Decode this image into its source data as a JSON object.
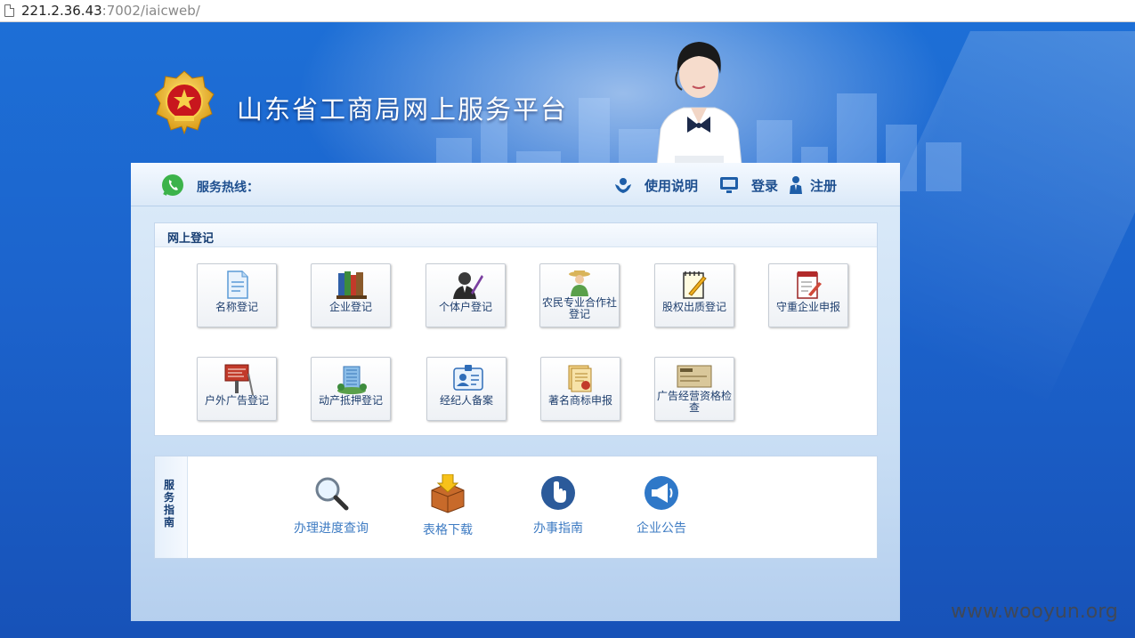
{
  "browser": {
    "url_host": "221.2.36.43",
    "url_path": ":7002/iaicweb/"
  },
  "header": {
    "site_title": "山东省工商局网上服务平台"
  },
  "topbar": {
    "hotline_label": "服务热线：",
    "help_label": "使用说明",
    "login_label": "登录",
    "register_label": "注册"
  },
  "online_registration": {
    "title": "网上登记",
    "items": [
      {
        "label": "名称登记",
        "icon": "document-icon"
      },
      {
        "label": "企业登记",
        "icon": "books-icon"
      },
      {
        "label": "个体户登记",
        "icon": "person-pen-icon"
      },
      {
        "label": "农民专业合作社登记",
        "icon": "farmer-icon"
      },
      {
        "label": "股权出质登记",
        "icon": "notepad-pen-icon"
      },
      {
        "label": "守重企业申报",
        "icon": "clipboard-icon"
      },
      {
        "label": "户外广告登记",
        "icon": "billboard-icon"
      },
      {
        "label": "动产抵押登记",
        "icon": "building-icon"
      },
      {
        "label": "经纪人备案",
        "icon": "id-card-icon"
      },
      {
        "label": "著名商标申报",
        "icon": "trademark-icon"
      },
      {
        "label": "广告经营资格检查",
        "icon": "check-icon"
      }
    ]
  },
  "service_guide": {
    "title": "服务指南",
    "items": [
      {
        "label": "办理进度查询",
        "icon": "magnifier-icon"
      },
      {
        "label": "表格下载",
        "icon": "download-box-icon"
      },
      {
        "label": "办事指南",
        "icon": "hand-pointer-icon"
      },
      {
        "label": "企业公告",
        "icon": "megaphone-icon"
      }
    ]
  },
  "watermark": "www.wooyun.org",
  "colors": {
    "background": "#1c63cc",
    "panel": "#dcebf9",
    "nav_text": "#1e4f8f",
    "guide_text": "#3f7cc3"
  }
}
